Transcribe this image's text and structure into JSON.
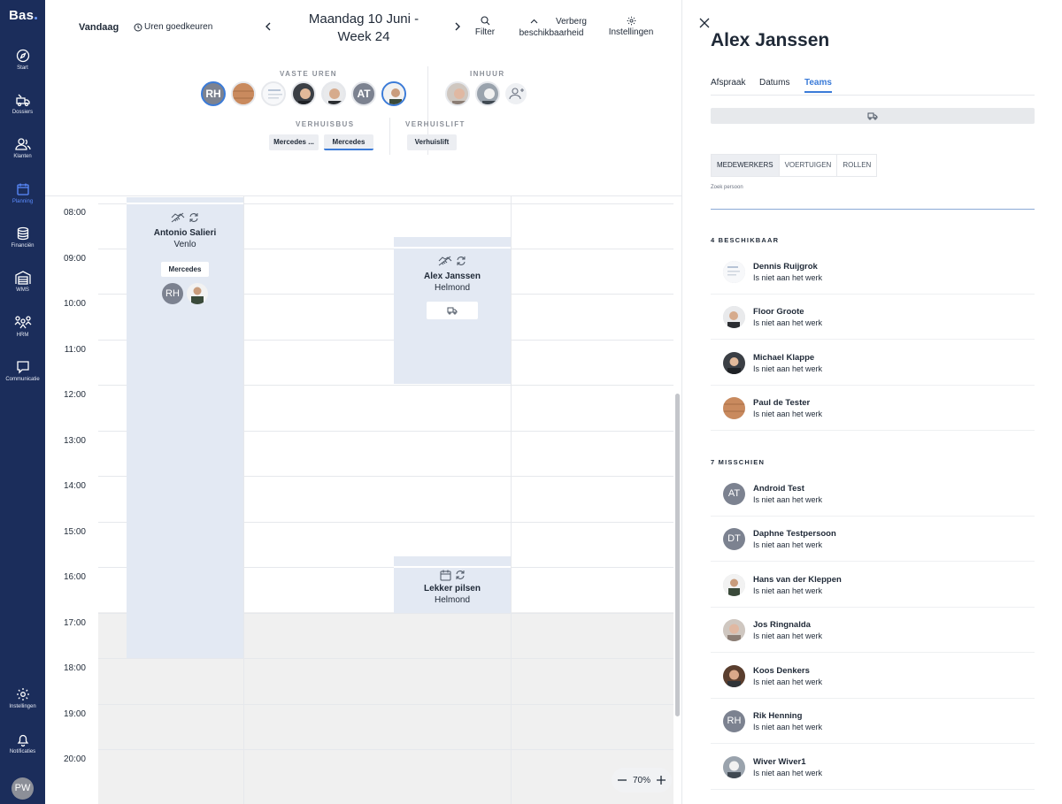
{
  "app": {
    "logo": "Bas"
  },
  "sidebar": {
    "items": [
      {
        "label": "Start",
        "icon": "compass-icon"
      },
      {
        "label": "Dossiers",
        "icon": "truck-icon"
      },
      {
        "label": "Klanten",
        "icon": "users-icon"
      },
      {
        "label": "Planning",
        "icon": "calendar-icon",
        "active": true
      },
      {
        "label": "Financiën",
        "icon": "coins-icon"
      },
      {
        "label": "WMS",
        "icon": "warehouse-icon"
      },
      {
        "label": "HRM",
        "icon": "people-icon"
      },
      {
        "label": "Communicatie",
        "icon": "chat-icon"
      }
    ],
    "bottom": [
      {
        "label": "Instellingen",
        "icon": "gear-icon"
      },
      {
        "label": "Notificaties",
        "icon": "bell-icon"
      }
    ],
    "user_initials": "PW"
  },
  "header": {
    "today": "Vandaag",
    "approve_hours": "Uren goedkeuren",
    "date_line1": "Maandag 10 Juni -",
    "date_line2": "Week 24",
    "filter": "Filter",
    "hide_line1": "Verberg",
    "hide_line2": "beschikbaarheid",
    "settings": "Instellingen"
  },
  "resources": {
    "fixed_hours_label": "VASTE UREN",
    "hire_label": "INHUUR",
    "bus_label": "VERHUISBUS",
    "lift_label": "VERHUISLIFT",
    "fixed_initials": [
      "RH",
      "AT"
    ],
    "bus_items": [
      "Mercedes ...",
      "Mercedes"
    ],
    "lift_items": [
      "Verhuislift"
    ]
  },
  "calendar": {
    "hours": [
      "08:00",
      "09:00",
      "10:00",
      "11:00",
      "12:00",
      "13:00",
      "14:00",
      "15:00",
      "16:00",
      "17:00",
      "18:00",
      "19:00",
      "20:00"
    ],
    "events": [
      {
        "title": "Antonio Salieri",
        "location": "Venlo",
        "vehicle": "Mercedes",
        "initials": "RH"
      },
      {
        "title": "Alex Janssen",
        "location": "Helmond"
      },
      {
        "title": "Lekker pilsen",
        "location": "Helmond"
      }
    ],
    "zoom": "70%"
  },
  "panel": {
    "title": "Alex Janssen",
    "tabs": [
      "Afspraak",
      "Datums",
      "Teams"
    ],
    "active_tab": "Teams",
    "subtabs": [
      "MEDEWERKERS",
      "VOERTUIGEN",
      "ROLLEN"
    ],
    "search_label": "Zoek persoon",
    "available_title": "4 BESCHIKBAAR",
    "available": [
      {
        "name": "Dennis Ruijgrok",
        "status": "Is niet aan het werk"
      },
      {
        "name": "Floor Groote",
        "status": "Is niet aan het werk"
      },
      {
        "name": "Michael Klappe",
        "status": "Is niet aan het werk"
      },
      {
        "name": "Paul de Tester",
        "status": "Is niet aan het werk"
      }
    ],
    "maybe_title": "7 MISSCHIEN",
    "maybe": [
      {
        "name": "Android Test",
        "status": "Is niet aan het werk",
        "initials": "AT"
      },
      {
        "name": "Daphne Testpersoon",
        "status": "Is niet aan het werk",
        "initials": "DT"
      },
      {
        "name": "Hans van der Kleppen",
        "status": "Is niet aan het werk"
      },
      {
        "name": "Jos Ringnalda",
        "status": "Is niet aan het werk"
      },
      {
        "name": "Koos Denkers",
        "status": "Is niet aan het werk"
      },
      {
        "name": "Rik Henning",
        "status": "Is niet aan het werk",
        "initials": "RH"
      },
      {
        "name": "Wiver Wiver1",
        "status": "Is niet aan het werk"
      }
    ]
  },
  "colors": {
    "sidebar": "#1b2d5b",
    "accent": "#3b7bd8",
    "event": "#e3e9f3"
  }
}
